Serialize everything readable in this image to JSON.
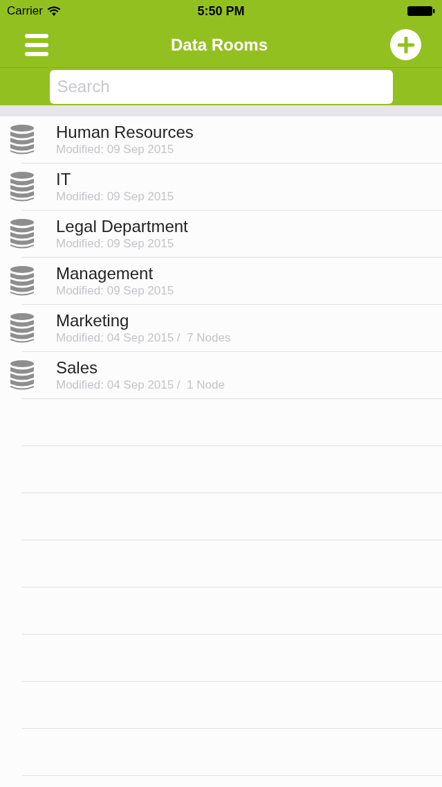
{
  "status_bar": {
    "carrier": "Carrier",
    "time": "5:50 PM"
  },
  "nav_bar": {
    "title": "Data Rooms"
  },
  "search": {
    "placeholder": "Search"
  },
  "rooms": [
    {
      "name": "Human Resources",
      "detail": "Modified: 09 Sep 2015"
    },
    {
      "name": "IT",
      "detail": "Modified: 09 Sep 2015"
    },
    {
      "name": "Legal Department",
      "detail": "Modified: 09 Sep 2015"
    },
    {
      "name": "Management",
      "detail": "Modified: 09 Sep 2015"
    },
    {
      "name": "Marketing",
      "detail": "Modified: 04 Sep 2015 /  7 Nodes"
    },
    {
      "name": "Sales",
      "detail": "Modified: 04 Sep 2015 /  1 Node"
    }
  ]
}
